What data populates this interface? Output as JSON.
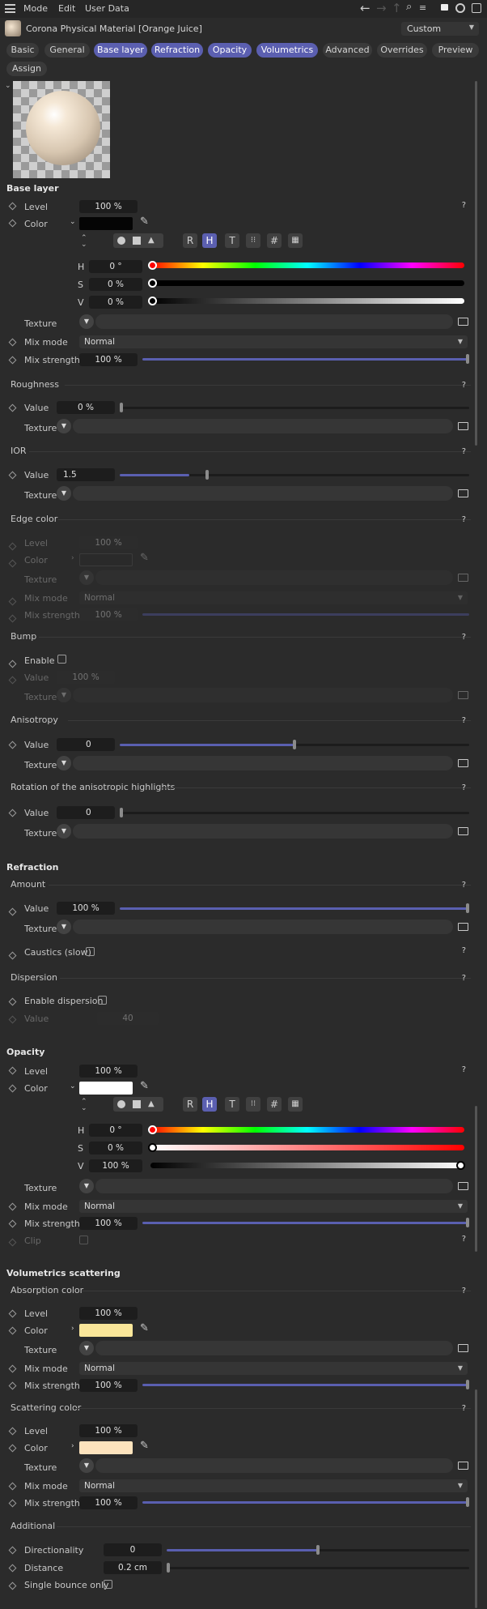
{
  "menu": {
    "mode": "Mode",
    "edit": "Edit",
    "userdata": "User Data"
  },
  "title": {
    "name": "Corona Physical Material [Orange Juice]",
    "preset": "Custom"
  },
  "tabs": [
    {
      "label": "Basic"
    },
    {
      "label": "General"
    },
    {
      "label": "Base layer"
    },
    {
      "label": "Refraction"
    },
    {
      "label": "Opacity"
    },
    {
      "label": "Volumetrics"
    },
    {
      "label": "Advanced"
    },
    {
      "label": "Overrides"
    },
    {
      "label": "Preview"
    },
    {
      "label": "Assign"
    }
  ],
  "base": {
    "header": "Base layer",
    "level_label": "Level",
    "level": "100 %",
    "color_label": "Color",
    "color": "#050505",
    "h": "0 °",
    "s": "0 %",
    "v": "0 %",
    "texture": "Texture",
    "mix_mode_label": "Mix mode",
    "mix_mode": "Normal",
    "mix_strength_label": "Mix strength",
    "mix_strength": "100 %"
  },
  "picker": {
    "r": "R",
    "h": "H",
    "t": "T",
    "hash": "#",
    "H": "H",
    "S": "S",
    "V": "V"
  },
  "rough": {
    "header": "Roughness",
    "value_label": "Value",
    "value": "0 %",
    "value_fraction": 0,
    "texture": "Texture"
  },
  "ior": {
    "header": "IOR",
    "value_label": "Value",
    "value": "1.5",
    "texture": "Texture"
  },
  "edge": {
    "header": "Edge color",
    "level_label": "Level",
    "level": "100 %",
    "color_label": "Color",
    "texture": "Texture",
    "mix_mode_label": "Mix mode",
    "mix_mode": "Normal",
    "mix_strength_label": "Mix strength",
    "mix_strength": "100 %"
  },
  "bump": {
    "header": "Bump",
    "enable_label": "Enable",
    "value_label": "Value",
    "value": "100 %",
    "texture": "Texture"
  },
  "aniso": {
    "header": "Anisotropy",
    "value_label": "Value",
    "value": "0",
    "texture": "Texture"
  },
  "rot": {
    "header": "Rotation of the anisotropic highlights",
    "value_label": "Value",
    "value": "0",
    "texture": "Texture"
  },
  "refr": {
    "header": "Refraction",
    "amount": "Amount",
    "value_label": "Value",
    "value": "100 %",
    "texture": "Texture",
    "caustics_label": "Caustics (slow)",
    "dispersion": "Dispersion",
    "enable_disp_label": "Enable dispersion",
    "disp_value_label": "Value",
    "disp_value": "40"
  },
  "opac": {
    "header": "Opacity",
    "level_label": "Level",
    "level": "100 %",
    "color_label": "Color",
    "color": "#ffffff",
    "h": "0 °",
    "s": "0 %",
    "v": "100 %",
    "texture": "Texture",
    "mix_mode_label": "Mix mode",
    "mix_mode": "Normal",
    "mix_strength_label": "Mix strength",
    "mix_strength": "100 %",
    "clip_label": "Clip"
  },
  "vol": {
    "header": "Volumetrics scattering",
    "absorb": "Absorption color",
    "a_level_label": "Level",
    "a_level": "100 %",
    "a_color_label": "Color",
    "a_color": "#fbe79a",
    "a_texture": "Texture",
    "a_mix_mode_label": "Mix mode",
    "a_mix_mode": "Normal",
    "a_mix_strength_label": "Mix strength",
    "a_mix_strength": "100 %",
    "scatter": "Scattering color",
    "s_level_label": "Level",
    "s_level": "100 %",
    "s_color_label": "Color",
    "s_color": "#fde3bd",
    "s_texture": "Texture",
    "s_mix_mode_label": "Mix mode",
    "s_mix_mode": "Normal",
    "s_mix_strength_label": "Mix strength",
    "s_mix_strength": "100 %",
    "additional": "Additional",
    "dir_label": "Directionality",
    "dir": "0",
    "dist_label": "Distance",
    "dist": "0.2 cm",
    "single_label": "Single bounce only"
  },
  "icons": {
    "menu": "hamburger-icon",
    "help": "?"
  }
}
